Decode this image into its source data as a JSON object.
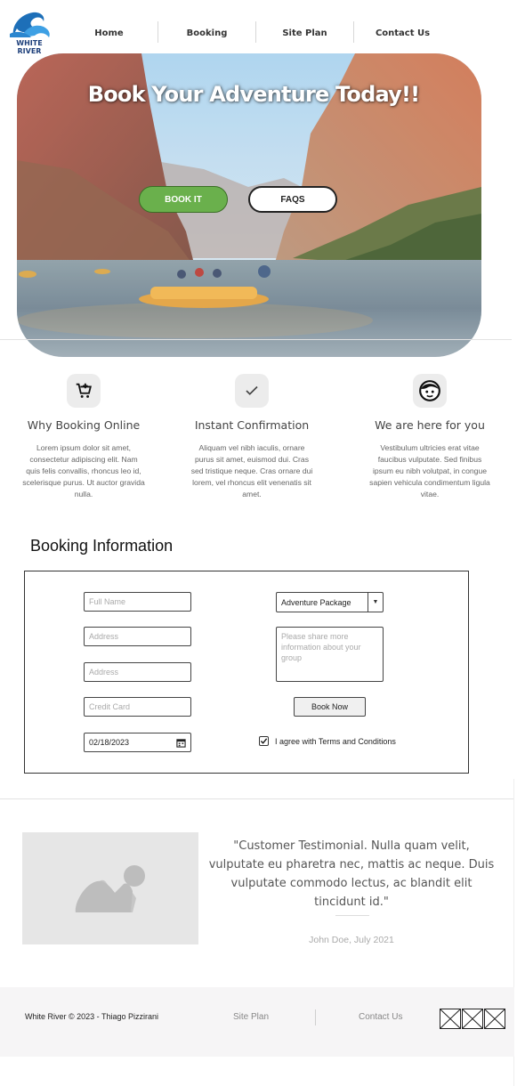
{
  "brand": {
    "logo_text": "WHITE RIVER"
  },
  "nav": {
    "items": [
      "Home",
      "Booking",
      "Site Plan",
      "Contact Us"
    ]
  },
  "hero": {
    "title": "Book Your Adventure Today!!",
    "book_button": "BOOK IT",
    "faqs_button": "FAQS"
  },
  "features": [
    {
      "icon": "cart-add-icon",
      "title": "Why Booking Online",
      "text": "Lorem ipsum dolor sit amet, consectetur adipiscing elit. Nam quis felis convallis, rhoncus leo id, scelerisque purus. Ut auctor gravida nulla."
    },
    {
      "icon": "checkmark-icon",
      "title": "Instant Confirmation",
      "text": "Aliquam vel nibh iaculis, ornare purus sit amet, euismod dui. Cras sed tristique neque. Cras ornare dui lorem, vel rhoncus elit venenatis sit amet."
    },
    {
      "icon": "face-icon",
      "title": "We are here for you",
      "text": "Vestibulum ultricies erat vitae faucibus vulputate. Sed finibus ipsum eu nibh volutpat, in congue sapien vehicula condimentum ligula vitae."
    }
  ],
  "booking": {
    "title": "Booking Information",
    "full_name_placeholder": "Full Name",
    "address_placeholder": "Address",
    "address2_placeholder": "Address",
    "credit_card_placeholder": "Credit Card",
    "date_value": "02/18/2023",
    "package_selected": "Adventure Package",
    "notes_placeholder": "Please share more information about your group",
    "submit_label": "Book Now",
    "terms_label": "I agree with Terms and Conditions",
    "terms_checked": true
  },
  "testimonial": {
    "quote": "\"Customer Testimonial. Nulla quam velit, vulputate eu pharetra nec, mattis ac neque. Duis vulputate commodo lectus, ac blandit elit tincidunt id.\"",
    "author": "John Doe, July 2021"
  },
  "footer": {
    "copyright": "White River © 2023 - Thiago Pizzirani",
    "links": [
      "Site Plan",
      "Contact Us"
    ],
    "social_icons": [
      "social-icon-placeholder",
      "social-icon-placeholder",
      "social-icon-placeholder"
    ]
  },
  "colors": {
    "accent_green": "#6ab04c",
    "brand_blue": "#1d6fb8",
    "footer_bg": "#f6f5f6"
  }
}
